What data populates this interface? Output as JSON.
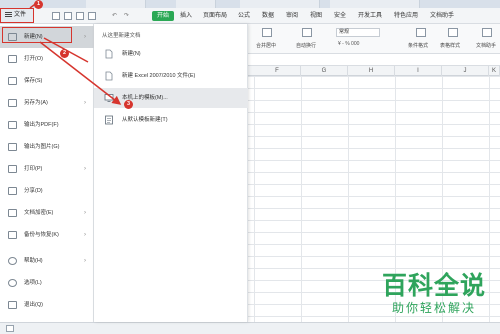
{
  "file_button": {
    "label": "文件"
  },
  "menubar": {
    "start_label": "开始",
    "items": [
      "插入",
      "页面布局",
      "公式",
      "数据",
      "审阅",
      "视图",
      "安全",
      "开发工具",
      "特色应用",
      "文档助手"
    ]
  },
  "ribbon": {
    "merge_center": "合并居中",
    "auto_wrap": "自动换行",
    "number_format": "常规",
    "cond_format": "条件格式",
    "table_style": "表格样式",
    "doc_helper": "文档助手"
  },
  "columns": [
    "F",
    "G",
    "H",
    "I",
    "J",
    "K"
  ],
  "left_menu": {
    "items": [
      {
        "label": "新建(N)",
        "has_submenu": true,
        "active": true
      },
      {
        "label": "打开(O)",
        "has_submenu": false
      },
      {
        "label": "保存(S)",
        "has_submenu": false
      },
      {
        "label": "另存为(A)",
        "has_submenu": true
      },
      {
        "label": "输出为PDF(F)",
        "has_submenu": false
      },
      {
        "label": "输出为图片(G)",
        "has_submenu": false
      },
      {
        "label": "打印(P)",
        "has_submenu": true
      },
      {
        "label": "分享(D)",
        "has_submenu": false
      },
      {
        "label": "文档加密(E)",
        "has_submenu": true
      },
      {
        "label": "备份与恢复(K)",
        "has_submenu": true
      },
      {
        "label": "帮助(H)",
        "has_submenu": true
      },
      {
        "label": "选项(L)",
        "has_submenu": false
      },
      {
        "label": "退出(Q)",
        "has_submenu": false
      }
    ]
  },
  "submenu": {
    "header": "从这里新建文档",
    "items": [
      {
        "label": "新建(N)"
      },
      {
        "label": "新建 Excel 2007/2010 文件(E)"
      },
      {
        "label": "本机上的模板(M)...",
        "hover": true
      },
      {
        "label": "从默认模板新建(T)"
      }
    ]
  },
  "badges": [
    "1",
    "2",
    "3"
  ],
  "watermark": {
    "line1": "百科全说",
    "line2": "助你轻松解决"
  },
  "colors": {
    "accent_red": "#d6352e",
    "start_green": "#2aa855",
    "watermark_green": "#2fa45c"
  }
}
